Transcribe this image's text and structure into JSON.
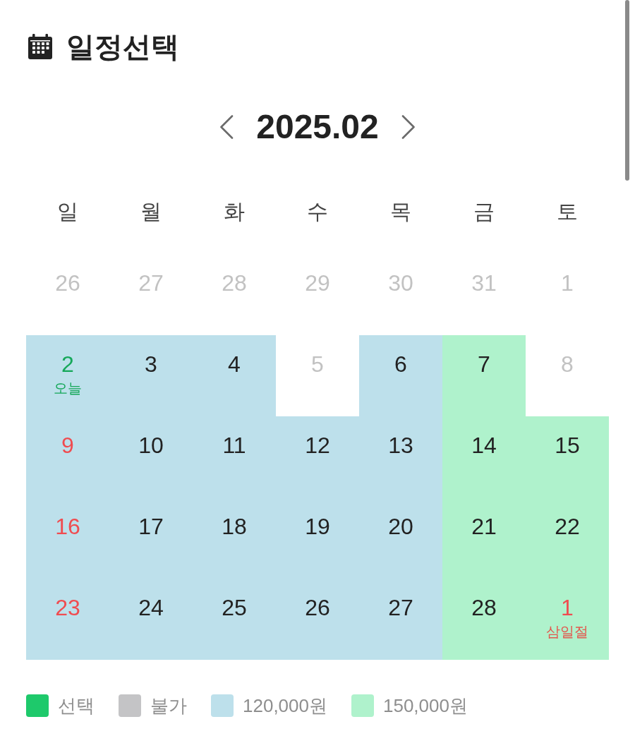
{
  "header": {
    "title": "일정선택"
  },
  "calendar": {
    "month": "2025.02",
    "weekdays": [
      "일",
      "월",
      "화",
      "수",
      "목",
      "금",
      "토"
    ],
    "weeks": [
      {
        "days": [
          {
            "day": "26",
            "kind": "unavailable",
            "holiday": false,
            "today": false,
            "selected": false
          },
          {
            "day": "27",
            "kind": "unavailable",
            "holiday": false,
            "today": false,
            "selected": false
          },
          {
            "day": "28",
            "kind": "unavailable",
            "holiday": false,
            "today": false,
            "selected": false
          },
          {
            "day": "29",
            "kind": "unavailable",
            "holiday": false,
            "today": false,
            "selected": false
          },
          {
            "day": "30",
            "kind": "unavailable",
            "holiday": false,
            "today": false,
            "selected": false
          },
          {
            "day": "31",
            "kind": "unavailable",
            "holiday": false,
            "today": false,
            "selected": false
          },
          {
            "day": "1",
            "kind": "unavailable",
            "holiday": false,
            "today": false,
            "selected": false
          }
        ]
      },
      {
        "days": [
          {
            "day": "2",
            "note": "오늘",
            "kind": "standard",
            "holiday": false,
            "today": true,
            "selected": false
          },
          {
            "day": "3",
            "kind": "standard",
            "holiday": false,
            "today": false,
            "selected": false
          },
          {
            "day": "4",
            "kind": "standard",
            "holiday": false,
            "today": false,
            "selected": false
          },
          {
            "day": "5",
            "kind": "unavailable",
            "holiday": false,
            "today": false,
            "selected": false
          },
          {
            "day": "6",
            "kind": "standard",
            "holiday": false,
            "today": false,
            "selected": false
          },
          {
            "day": "7",
            "kind": "peak",
            "holiday": false,
            "today": false,
            "selected": false
          },
          {
            "day": "8",
            "kind": "unavailable",
            "holiday": false,
            "today": false,
            "selected": false
          }
        ]
      },
      {
        "days": [
          {
            "day": "9",
            "kind": "standard",
            "holiday": true,
            "today": false,
            "selected": false
          },
          {
            "day": "10",
            "kind": "standard",
            "holiday": false,
            "today": false,
            "selected": false
          },
          {
            "day": "11",
            "kind": "standard",
            "holiday": false,
            "today": false,
            "selected": false
          },
          {
            "day": "12",
            "kind": "standard",
            "holiday": false,
            "today": false,
            "selected": false
          },
          {
            "day": "13",
            "kind": "standard",
            "holiday": false,
            "today": false,
            "selected": false
          },
          {
            "day": "14",
            "kind": "peak",
            "holiday": false,
            "today": false,
            "selected": false
          },
          {
            "day": "15",
            "kind": "peak",
            "holiday": false,
            "today": false,
            "selected": false
          }
        ]
      },
      {
        "days": [
          {
            "day": "16",
            "kind": "standard",
            "holiday": true,
            "today": false,
            "selected": false
          },
          {
            "day": "17",
            "kind": "standard",
            "holiday": false,
            "today": false,
            "selected": false
          },
          {
            "day": "18",
            "kind": "standard",
            "holiday": false,
            "today": false,
            "selected": false
          },
          {
            "day": "19",
            "kind": "standard",
            "holiday": false,
            "today": false,
            "selected": false
          },
          {
            "day": "20",
            "kind": "standard",
            "holiday": false,
            "today": false,
            "selected": false
          },
          {
            "day": "21",
            "kind": "peak",
            "holiday": false,
            "today": false,
            "selected": false
          },
          {
            "day": "22",
            "kind": "peak",
            "holiday": false,
            "today": false,
            "selected": false
          }
        ]
      },
      {
        "days": [
          {
            "day": "23",
            "kind": "standard",
            "holiday": true,
            "today": false,
            "selected": false
          },
          {
            "day": "24",
            "kind": "standard",
            "holiday": false,
            "today": false,
            "selected": false
          },
          {
            "day": "25",
            "kind": "standard",
            "holiday": false,
            "today": false,
            "selected": false
          },
          {
            "day": "26",
            "kind": "standard",
            "holiday": false,
            "today": false,
            "selected": false
          },
          {
            "day": "27",
            "kind": "standard",
            "holiday": false,
            "today": false,
            "selected": false
          },
          {
            "day": "28",
            "kind": "peak",
            "holiday": false,
            "today": false,
            "selected": false
          },
          {
            "day": "1",
            "note": "삼일절",
            "kind": "peak",
            "holiday": true,
            "today": false,
            "selected": false
          }
        ]
      }
    ]
  },
  "legend": [
    {
      "kind": "selected",
      "label": "선택",
      "color": "#1ec96b"
    },
    {
      "kind": "unavailable",
      "label": "불가",
      "color": "#c4c4c6"
    },
    {
      "kind": "standard",
      "label": "120,000원",
      "color": "#bde0eb"
    },
    {
      "kind": "peak",
      "label": "150,000원",
      "color": "#aff2cc"
    }
  ]
}
